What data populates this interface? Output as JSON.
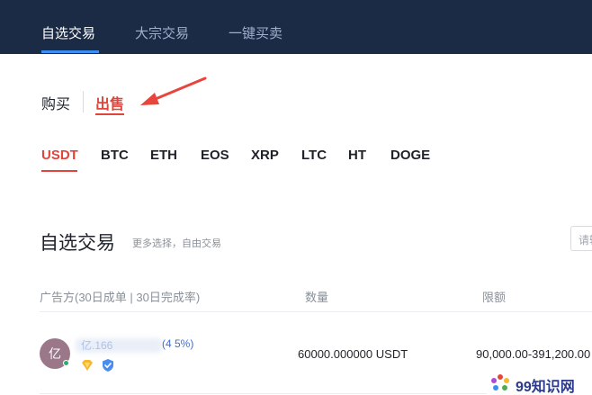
{
  "topnav": {
    "tabs": [
      {
        "label": "自选交易",
        "active": true
      },
      {
        "label": "大宗交易",
        "active": false
      },
      {
        "label": "一键买卖",
        "active": false
      }
    ]
  },
  "trade_side": {
    "buy_label": "购买",
    "sell_label": "出售",
    "selected": "出售"
  },
  "coins": {
    "items": [
      "USDT",
      "BTC",
      "ETH",
      "EOS",
      "XRP",
      "LTC",
      "HT",
      "DOGE"
    ],
    "selected": "USDT"
  },
  "section": {
    "title": "自选交易",
    "subtitle": "更多选择，自由交易",
    "search_placeholder": "请输"
  },
  "table": {
    "headers": {
      "advertiser": "广告方(30日成单 | 30日完成率)",
      "quantity": "数量",
      "limit": "限额"
    },
    "rows": [
      {
        "avatar_text": "亿",
        "advertiser_name": "亿.166",
        "advertiser_stats": "(4    5%)",
        "quantity": "60000.000000 USDT",
        "limit": "90,000.00-391,200.00"
      }
    ]
  },
  "watermark": {
    "text": "99知识网"
  },
  "colors": {
    "nav_bg": "#1b2a45",
    "accent_red": "#e0443a",
    "accent_blue": "#3a8ef6",
    "link_blue": "#3a6fd8"
  }
}
